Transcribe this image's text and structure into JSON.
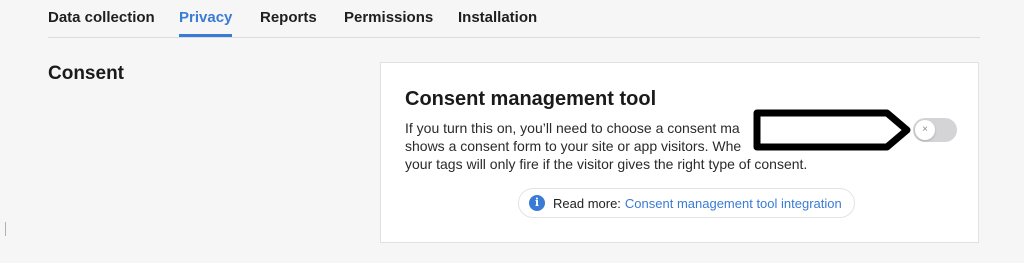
{
  "tabs": [
    {
      "label": "Data collection",
      "active": false
    },
    {
      "label": "Privacy",
      "active": true
    },
    {
      "label": "Reports",
      "active": false
    },
    {
      "label": "Permissions",
      "active": false
    },
    {
      "label": "Installation",
      "active": false
    }
  ],
  "section": {
    "title": "Consent"
  },
  "card": {
    "title": "Consent management tool",
    "description_lines": [
      "If you turn this on, you’ll need to choose a consent ma",
      "shows a consent form to your site or app visitors. Whe",
      "your tags will only fire if the visitor gives the right type of consent."
    ],
    "toggle": {
      "state": "off",
      "knob_glyph": "×"
    },
    "info": {
      "icon": "info-icon",
      "icon_glyph": "i",
      "prefix": "Read more:",
      "link": "Consent management tool integration"
    }
  },
  "colors": {
    "accent": "#3a7bd5",
    "background": "#f6f6f7",
    "card": "#ffffff",
    "toggle_off": "#d4d4d6"
  }
}
